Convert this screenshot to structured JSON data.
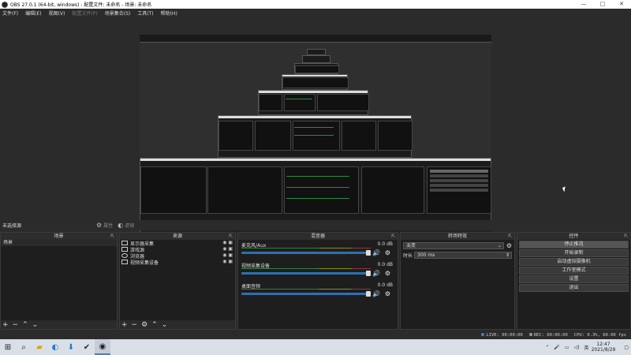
{
  "window": {
    "title": "OBS 27.0.1 (64-bit, windows) - 配置文件: 未命名 - 场景: 未命名",
    "controls": [
      "—",
      "□",
      "✕"
    ]
  },
  "menu": {
    "items": [
      "文件(F)",
      "编辑(E)",
      "视图(V)",
      "配置文件(P)",
      "场景集合(S)",
      "工具(T)",
      "帮助(H)"
    ]
  },
  "context_bar": {
    "source": "未选择源",
    "properties_label": "属性",
    "filters_label": "滤镜"
  },
  "scenes": {
    "title": "场景",
    "items": [
      "场景"
    ]
  },
  "sources": {
    "title": "来源",
    "items": [
      "显示器采集",
      "游戏源",
      "浏览器",
      "视频采集设备"
    ]
  },
  "mixer": {
    "title": "混音器",
    "channels": [
      {
        "name": "麦克风/Aux",
        "db": "0.0 dB"
      },
      {
        "name": "视频采集设备",
        "db": "0.0 dB"
      },
      {
        "name": "桌面音频",
        "db": "0.0 dB"
      }
    ]
  },
  "transitions": {
    "title": "转场特效",
    "selected": "淡变",
    "duration_label": "时长",
    "duration_value": "300 ms"
  },
  "controls": {
    "title": "控件",
    "buttons": [
      "停止推流",
      "开始录制",
      "启动虚拟摄像机",
      "工作室模式",
      "设置",
      "退出"
    ]
  },
  "status": {
    "live": "LIVE: 00:00:00",
    "rec": "REC: 00:00:00",
    "cpu": "CPU: 0.3%, 60.00 fps"
  },
  "taskbar": {
    "time": "12:47",
    "date": "2021/8/29",
    "ime": "英"
  },
  "colors": {
    "meter_green": "#3a7a3a",
    "meter_yellow": "#8a8a2a",
    "meter_red": "#8a3a3a",
    "volume_blue": "#2f6fb0"
  }
}
